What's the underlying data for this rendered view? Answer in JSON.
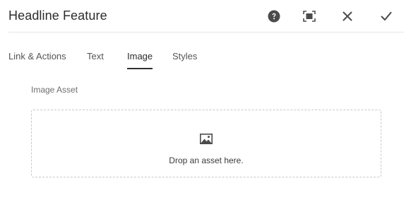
{
  "dialog": {
    "title": "Headline Feature",
    "actions": {
      "help": "help-icon",
      "fullscreen": "fullscreen-icon",
      "close": "close-icon",
      "done": "checkmark-icon"
    }
  },
  "tabs": [
    {
      "label": "Link & Actions",
      "active": false
    },
    {
      "label": "Text",
      "active": false
    },
    {
      "label": "Image",
      "active": true
    },
    {
      "label": "Styles",
      "active": false
    }
  ],
  "image_tab": {
    "field_label": "Image Asset",
    "dropzone": {
      "icon": "image-icon",
      "text": "Drop an asset here."
    }
  },
  "colors": {
    "text_primary": "#2c2c2c",
    "text_secondary": "#6e6e6e",
    "active_tab_underline": "#323232",
    "divider": "#e6e6e6",
    "dropzone_border": "#c8c8c8"
  }
}
